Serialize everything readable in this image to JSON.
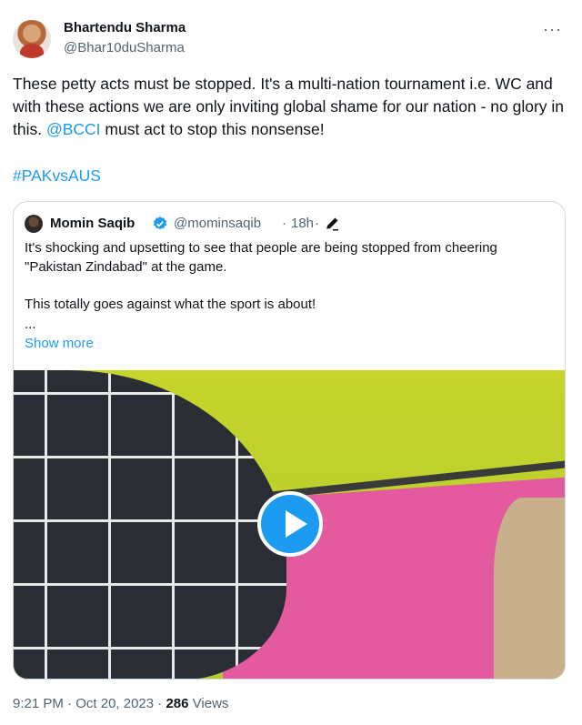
{
  "tweet": {
    "author_name": "Bhartendu Sharma",
    "author_handle": "@Bhar10duSharma",
    "more_icon": "more-horizontal-icon",
    "text_part1": "These petty acts must be stopped. It's a multi-nation tournament i.e. WC and with these actions we are only inviting global shame for our nation - no glory in this. ",
    "mention": "@BCCI",
    "text_part2": " must act to stop this nonsense!",
    "hashtag": "#PAKvsAUS",
    "time": "9:21 PM",
    "date": "Oct 20, 2023",
    "separator": "·",
    "views_count": "286",
    "views_label": "Views"
  },
  "quote": {
    "author_name": "Momin Saqib",
    "verified_icon": "verified-badge-icon",
    "author_handle": "@mominsaqib",
    "separator": "·",
    "time": "18h",
    "edit_icon": "edit-pencil-icon",
    "line1": "It's shocking and upsetting to see that people are being stopped from cheering \"Pakistan Zindabad\" at the game.",
    "line2": "This totally goes against what the sport is about!",
    "ellipsis": "...",
    "show_more": "Show more",
    "play_icon": "play-icon"
  },
  "colors": {
    "link": "#1d9bf0",
    "secondary_text": "#536471",
    "border": "#cfd9de"
  }
}
